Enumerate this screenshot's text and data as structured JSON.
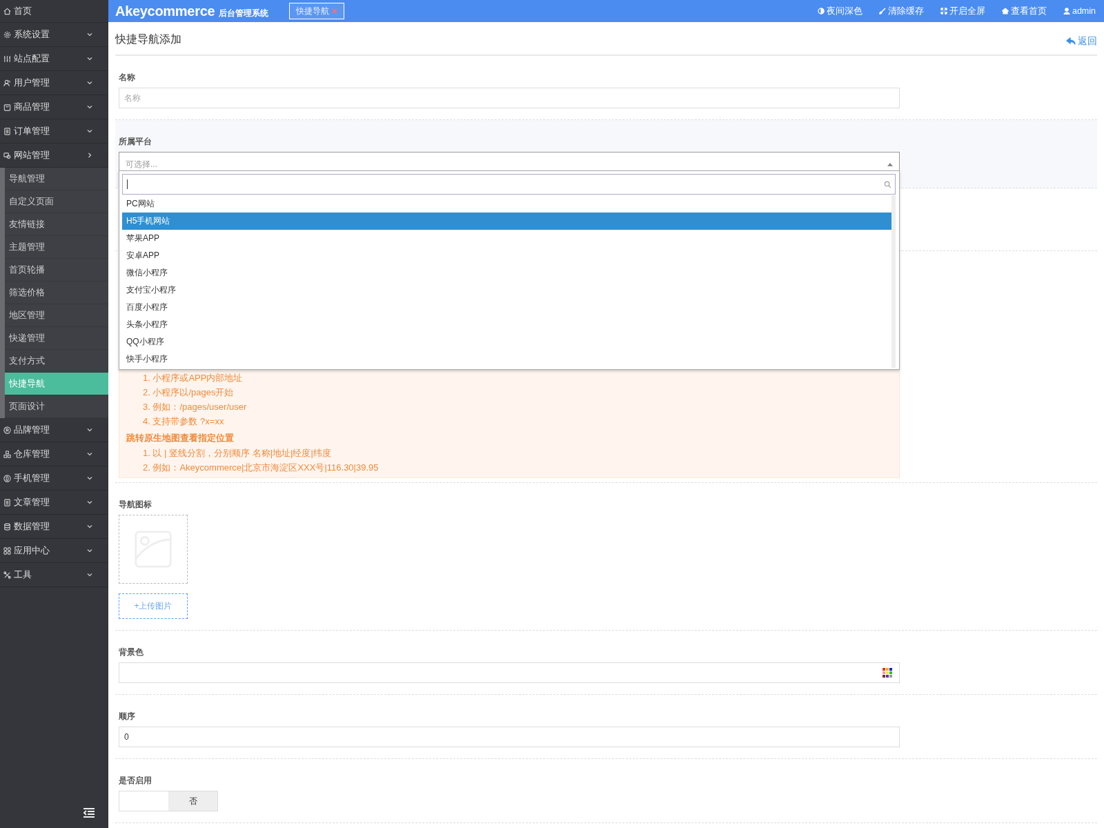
{
  "topbar": {
    "brand": "Akeycommerce",
    "brand_sub": "后台管理系统",
    "tabs": [
      {
        "label": "快捷导航",
        "selected": true
      }
    ],
    "actions": [
      {
        "label": "夜间深色"
      },
      {
        "label": "清除缓存"
      },
      {
        "label": "开启全屏"
      },
      {
        "label": "查看首页"
      },
      {
        "label": "admin"
      }
    ]
  },
  "sidebar": {
    "home": "首页",
    "items": [
      {
        "label": "系统设置",
        "expanded": false
      },
      {
        "label": "站点配置",
        "expanded": false
      },
      {
        "label": "用户管理",
        "expanded": false
      },
      {
        "label": "商品管理",
        "expanded": false
      },
      {
        "label": "订单管理",
        "expanded": false
      },
      {
        "label": "网站管理",
        "expanded": true,
        "children": [
          {
            "label": "导航管理",
            "selected": false
          },
          {
            "label": "自定义页面",
            "selected": false
          },
          {
            "label": "友情链接",
            "selected": false
          },
          {
            "label": "主题管理",
            "selected": false
          },
          {
            "label": "首页轮播",
            "selected": false
          },
          {
            "label": "筛选价格",
            "selected": false
          },
          {
            "label": "地区管理",
            "selected": false
          },
          {
            "label": "快递管理",
            "selected": false
          },
          {
            "label": "支付方式",
            "selected": false
          },
          {
            "label": "快捷导航",
            "selected": true
          },
          {
            "label": "页面设计",
            "selected": false
          }
        ]
      },
      {
        "label": "品牌管理",
        "expanded": false
      },
      {
        "label": "仓库管理",
        "expanded": false
      },
      {
        "label": "手机管理",
        "expanded": false
      },
      {
        "label": "文章管理",
        "expanded": false
      },
      {
        "label": "数据管理",
        "expanded": false
      },
      {
        "label": "应用中心",
        "expanded": false
      },
      {
        "label": "工具",
        "expanded": false
      }
    ]
  },
  "page": {
    "title": "快捷导航添加",
    "back": "返回"
  },
  "form": [
    {
      "kind": "text",
      "label": "名称",
      "placeholder": "名称"
    },
    {
      "kind": "select",
      "label": "所属平台",
      "placeholder": "可选择...",
      "open": true,
      "options": [
        {
          "label": "PC网站",
          "selected": false
        },
        {
          "label": "H5手机网站",
          "selected": true
        },
        {
          "label": "苹果APP",
          "selected": false
        },
        {
          "label": "安卓APP",
          "selected": false
        },
        {
          "label": "微信小程序",
          "selected": false
        },
        {
          "label": "支付宝小程序",
          "selected": false
        },
        {
          "label": "百度小程序",
          "selected": false
        },
        {
          "label": "头条小程序",
          "selected": false
        },
        {
          "label": "QQ小程序",
          "selected": false
        },
        {
          "label": "快手小程序",
          "selected": false
        }
      ]
    },
    {
      "kind": "notes",
      "groups": [
        {
          "items": [
            "1. 小程序或APP内部地址",
            "2. 小程序以/pages开始",
            "3. 例如：/pages/user/user",
            "4. 支持带参数 ?x=xx"
          ]
        },
        {
          "heading": "跳转原生地图查看指定位置",
          "items": [
            "1. 以 | 竖线分割，分别顺序 名称|地址|经度|纬度",
            "2. 例如：Akeycommerce|北京市海淀区XXX号|116.30|39.95"
          ]
        }
      ]
    },
    {
      "kind": "image",
      "label": "导航图标",
      "button": "+上传图片"
    },
    {
      "kind": "color",
      "label": "背景色"
    },
    {
      "kind": "text",
      "label": "顺序",
      "value": "0"
    },
    {
      "kind": "switch",
      "label": "是否启用",
      "on": false,
      "off_label": "否"
    }
  ]
}
